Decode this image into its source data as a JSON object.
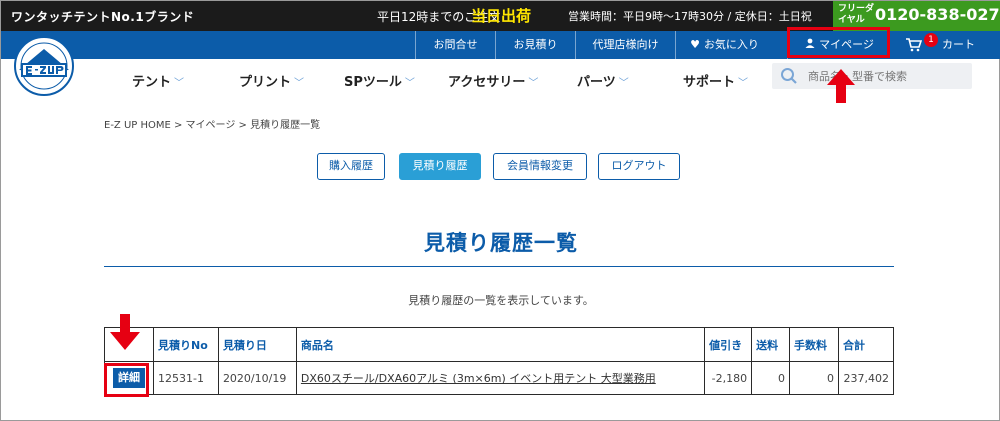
{
  "topbar": {
    "slogan": "ワンタッチテントNo.1ブランド",
    "order_text": "平日12時までのご注文",
    "same_day": "当日出荷",
    "hours": "営業時間：平日9時〜17時30分 / 定休日：土日祝",
    "free_dial_label": "フリーダイヤル",
    "phone": "0120-838-027"
  },
  "utility_nav": {
    "contact": "お問合せ",
    "quote": "お見積り",
    "dealer": "代理店様向け",
    "favorites": "お気に入り",
    "mypage": "マイページ",
    "cart": "カート",
    "cart_count": "1"
  },
  "main_nav": [
    "テント",
    "プリント",
    "SPツール",
    "アクセサリー",
    "パーツ",
    "サポート"
  ],
  "search": {
    "placeholder": "商品名・型番で検索"
  },
  "breadcrumb": "E-Z UP HOME > マイページ > 見積り履歴一覧",
  "account_tabs": {
    "purchase_history": "購入履歴",
    "quote_history": "見積り履歴",
    "member_info": "会員情報変更",
    "logout": "ログアウト"
  },
  "page_title": "見積り履歴一覧",
  "description": "見積り履歴の一覧を表示しています。",
  "table": {
    "headers": [
      "",
      "見積りNo",
      "見積り日",
      "商品名",
      "値引き",
      "送料",
      "手数料",
      "合計"
    ],
    "rows": [
      {
        "action": "詳細",
        "quote_no": "12531-1",
        "date": "2020/10/19",
        "product": "DX60スチール/DXA60アルミ (3m×6m) イベント用テント 大型業務用",
        "discount": "-2,180",
        "shipping": "0",
        "fee": "0",
        "total": "237,402"
      }
    ]
  },
  "colors": {
    "brand_blue": "#0c5ca9",
    "accent_blue": "#2a9fd6",
    "highlight_red": "#e60012",
    "free_dial_green": "#3c9a1f",
    "same_day_yellow": "#ffe600"
  }
}
